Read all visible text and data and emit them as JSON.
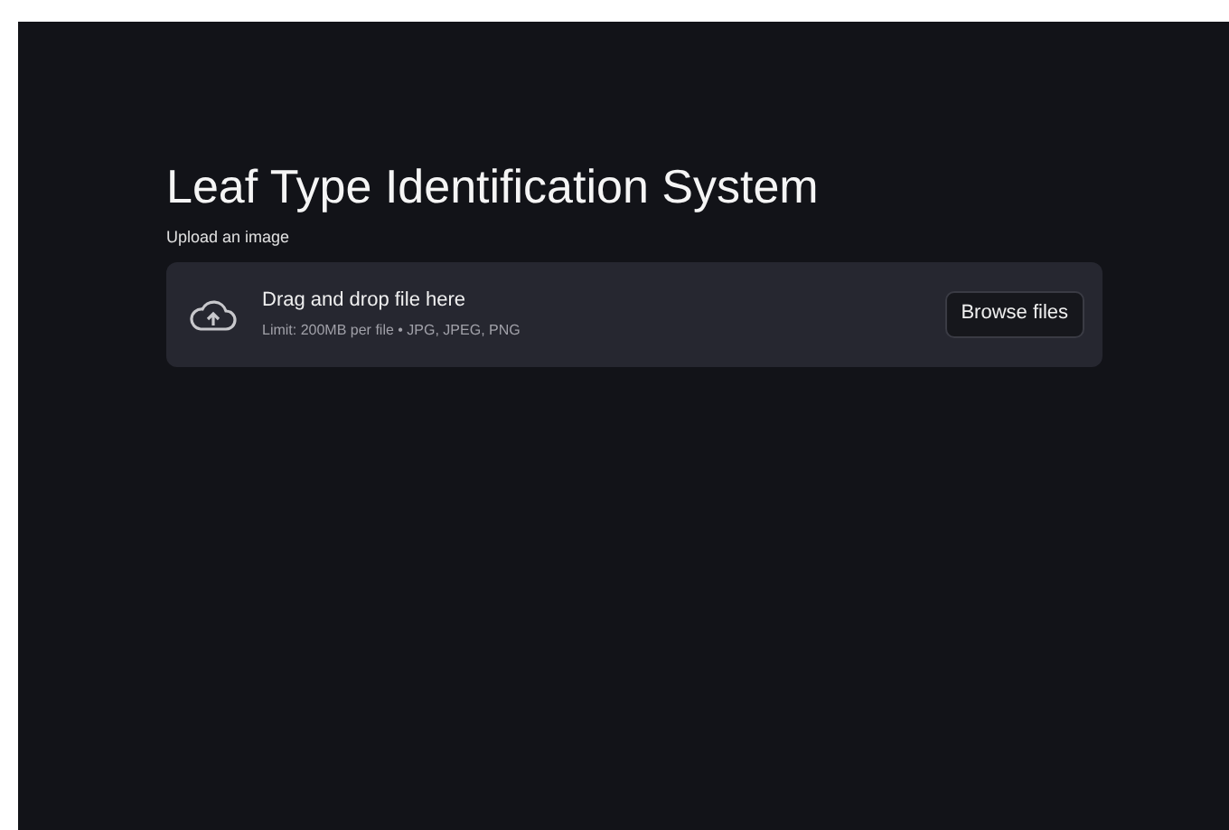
{
  "title": "Leaf Type Identification System",
  "uploader": {
    "label": "Upload an image",
    "instruction": "Drag and drop file here",
    "limit": "Limit: 200MB per file • JPG, JPEG, PNG",
    "button": "Browse files"
  }
}
